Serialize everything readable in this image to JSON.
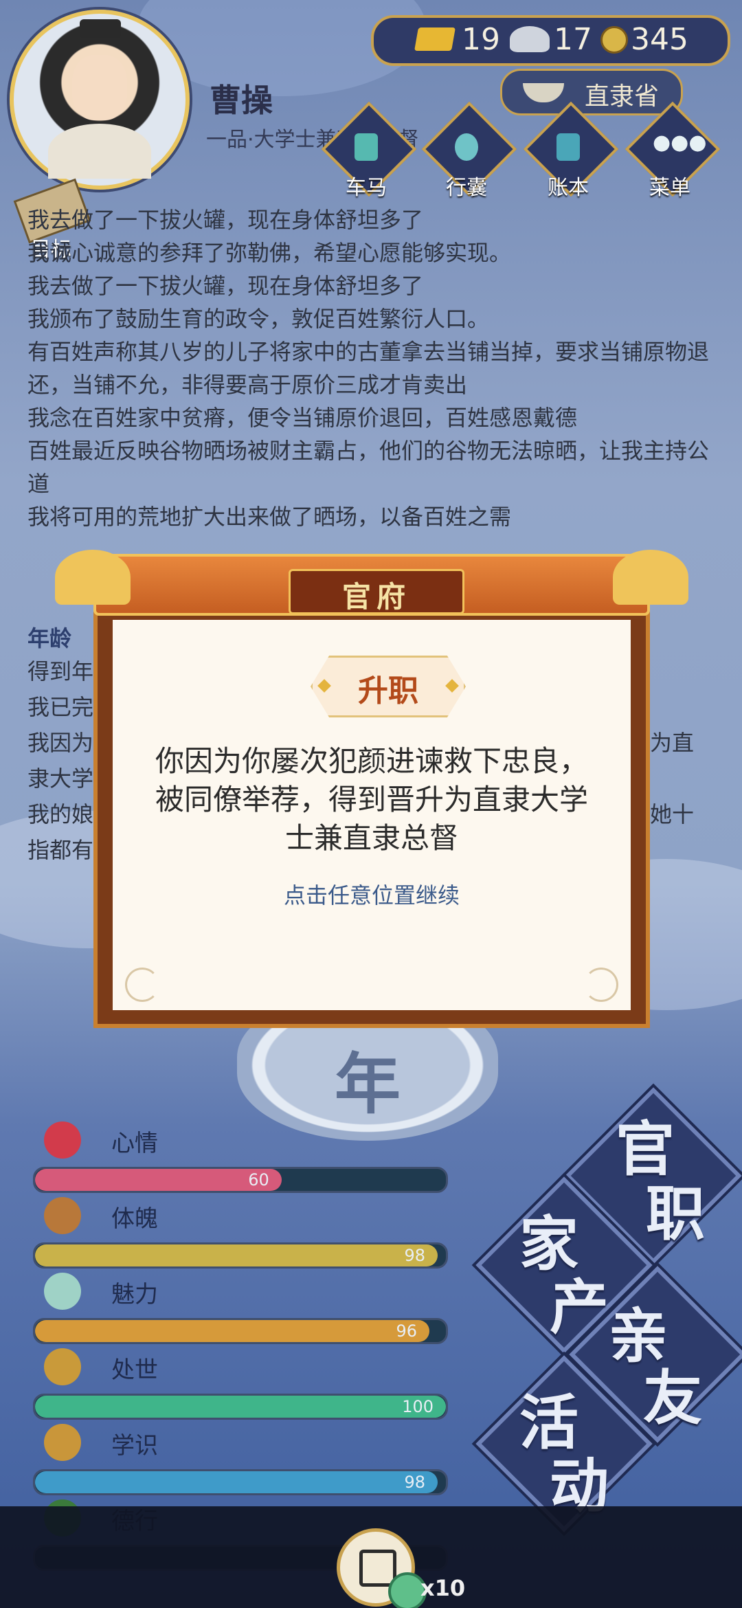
{
  "header": {
    "character_name": "曹操",
    "title_line": "一品·大学士兼直隶总督",
    "resources": {
      "gold": "19",
      "silver": "17",
      "coins": "345"
    },
    "province": "直隶省",
    "menu": [
      {
        "label": "车马"
      },
      {
        "label": "行囊"
      },
      {
        "label": "账本"
      },
      {
        "label": "菜单"
      }
    ],
    "goal_label": "目标"
  },
  "log": {
    "lines": [
      "我去做了一下拔火罐，现在身体舒坦多了",
      "我诚心诚意的参拜了弥勒佛，希望心愿能够实现。",
      "我去做了一下拔火罐，现在身体舒坦多了",
      "我颁布了鼓励生育的政令，敦促百姓繁衍人口。",
      "有百姓声称其八岁的儿子将家中的古董拿去当铺当掉，要求当铺原物退还，当铺不允，非得要高于原价三成才肯卖出",
      "我念在百姓家中贫瘠，便令当铺原价退回，百姓感恩戴德",
      "百姓最近反映谷物晒场被财主霸占，他们的谷物无法晾晒，让我主持公道",
      "我将可用的荒地扩大出来做了晒场，以备百姓之需"
    ],
    "partial_age": "年龄",
    "partial_1": "得到年",
    "partial_2": "我已完",
    "partial_3a": "我因为",
    "partial_3b": "为直",
    "partial_4": "隶大学",
    "partial_5a": "我的娘",
    "partial_5b": "她十",
    "partial_6": "指都有"
  },
  "seal_char": "年",
  "stats": [
    {
      "label": "心情",
      "value": 60,
      "color": "#d65a7a",
      "icon_color": "#d23b4b",
      "icon": "flower-icon"
    },
    {
      "label": "体魄",
      "value": 98,
      "color": "#c9b24a",
      "icon_color": "#b8783a",
      "icon": "body-icon"
    },
    {
      "label": "魅力",
      "value": 96,
      "color": "#d69a3a",
      "icon_color": "#9fd2c6",
      "icon": "mirror-icon"
    },
    {
      "label": "处世",
      "value": 100,
      "color": "#3fb58a",
      "icon_color": "#c99a3a",
      "icon": "hands-icon"
    },
    {
      "label": "学识",
      "value": 98,
      "color": "#3f9bc9",
      "icon_color": "#c9963a",
      "icon": "books-icon"
    },
    {
      "label": "德行",
      "value": null,
      "color": "#7a3a8a",
      "icon_color": "#3b7a3b",
      "icon": "virtue-icon"
    }
  ],
  "side_buttons": [
    {
      "c1": "官",
      "c2": "职"
    },
    {
      "c1": "家",
      "c2": "产"
    },
    {
      "c1": "亲",
      "c2": "友"
    },
    {
      "c1": "活",
      "c2": "动"
    }
  ],
  "bottom": {
    "multiplier": "x10"
  },
  "dialog": {
    "header": "官府",
    "badge": "升职",
    "message": "你因为你屡次犯颜进谏救下忠良，被同僚举荐，得到晋升为直隶大学士兼直隶总督",
    "hint": "点击任意位置继续"
  }
}
